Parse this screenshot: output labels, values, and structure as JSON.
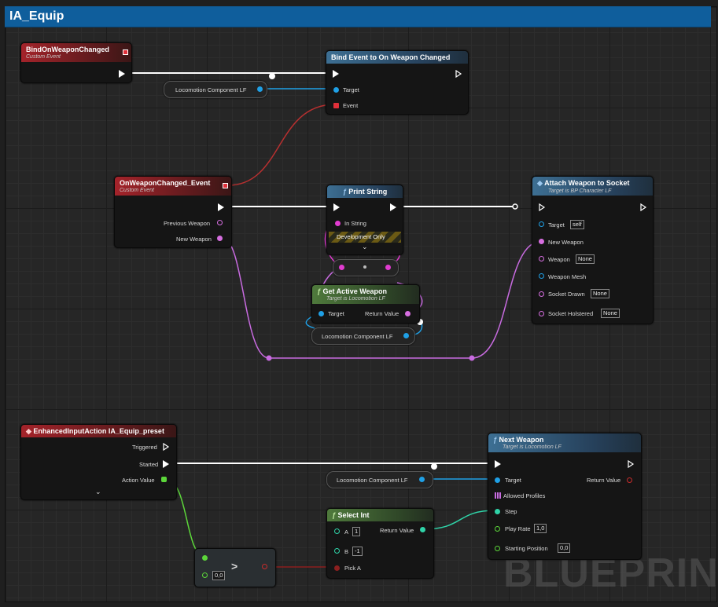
{
  "tab": {
    "title": "IA_Equip"
  },
  "watermark": "BLUEPRINT",
  "nodes": {
    "bind_on_weapon_changed": {
      "title": "BindOnWeaponChanged",
      "subtitle": "Custom Event"
    },
    "bind_event": {
      "title": "Bind Event to On Weapon Changed",
      "target": "Target",
      "event": "Event"
    },
    "locomotion_1": {
      "label": "Locomotion Component LF"
    },
    "on_weapon_changed": {
      "title": "OnWeaponChanged_Event",
      "subtitle": "Custom Event",
      "previous": "Previous Weapon",
      "new": "New Weapon"
    },
    "print_string": {
      "title": "Print String",
      "in_string": "In String",
      "dev_only": "Development Only"
    },
    "get_active_weapon": {
      "title": "Get Active Weapon",
      "subtitle": "Target is Locomotion LF",
      "target": "Target",
      "return": "Return Value"
    },
    "locomotion_2": {
      "label": "Locomotion Component LF"
    },
    "attach_weapon": {
      "title": "Attach Weapon to Socket",
      "subtitle": "Target is BP Character LF",
      "target": "Target",
      "target_val": "self",
      "new_weapon": "New Weapon",
      "weapon": "Weapon",
      "weapon_val": "None",
      "weapon_mesh": "Weapon Mesh",
      "socket_drawn": "Socket Drawn",
      "socket_drawn_val": "None",
      "socket_holstered": "Socket Holstered",
      "socket_holstered_val": "None"
    },
    "enhanced_input": {
      "title": "EnhancedInputAction IA_Equip_preset",
      "triggered": "Triggered",
      "started": "Started",
      "action_value": "Action Value"
    },
    "locomotion_3": {
      "label": "Locomotion Component LF"
    },
    "next_weapon": {
      "title": "Next Weapon",
      "subtitle": "Target is Locomotion LF",
      "target": "Target",
      "return": "Return Value",
      "allowed": "Allowed Profiles",
      "step": "Step",
      "play_rate": "Play Rate",
      "play_rate_val": "1,0",
      "starting_position": "Starting Position",
      "starting_position_val": "0,0"
    },
    "select_int": {
      "title": "Select Int",
      "a": "A",
      "a_val": "1",
      "b": "B",
      "b_val": "-1",
      "pick_a": "Pick A",
      "return": "Return Value"
    },
    "compare": {
      "op": ">",
      "val": "0,0"
    }
  },
  "colors": {
    "exec": "#ffffff",
    "object": "#1fa0e6",
    "weapon": "#d66ee0",
    "string": "#e13cd0",
    "int": "#2fd3a8",
    "vector": "#5cd63a",
    "bool": "#8c1f1f",
    "delegate": "#e0303a"
  }
}
